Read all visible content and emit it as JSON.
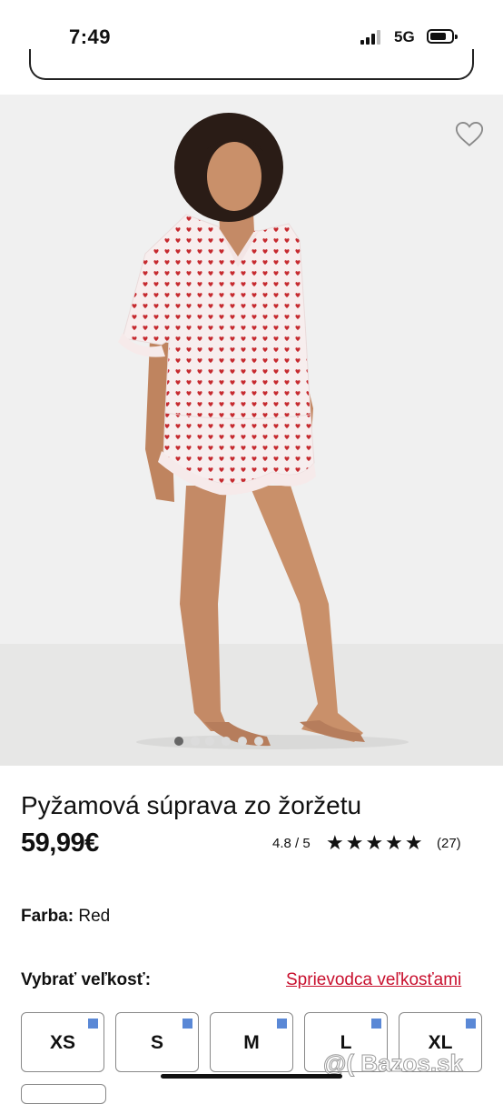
{
  "status": {
    "time": "7:49",
    "network": "5G"
  },
  "product": {
    "title": "Pyžamová súprava zo žoržetu",
    "price": "59,99€",
    "rating_text": "4.8 / 5",
    "stars": "★★★★★",
    "review_count": "(27)",
    "color_label": "Farba:",
    "color_value": "Red",
    "image_count": 6,
    "active_image": 1
  },
  "sizes": {
    "label": "Vybrať veľkosť:",
    "guide_link": "Sprievodca veľkosťami",
    "options": [
      "XS",
      "S",
      "M",
      "L",
      "XL"
    ]
  },
  "watermark": "@( Bazos.sk",
  "colors": {
    "accent_red": "#c8102e",
    "availability_blue": "#5a88d6",
    "heart_print": "#c62a2f"
  }
}
